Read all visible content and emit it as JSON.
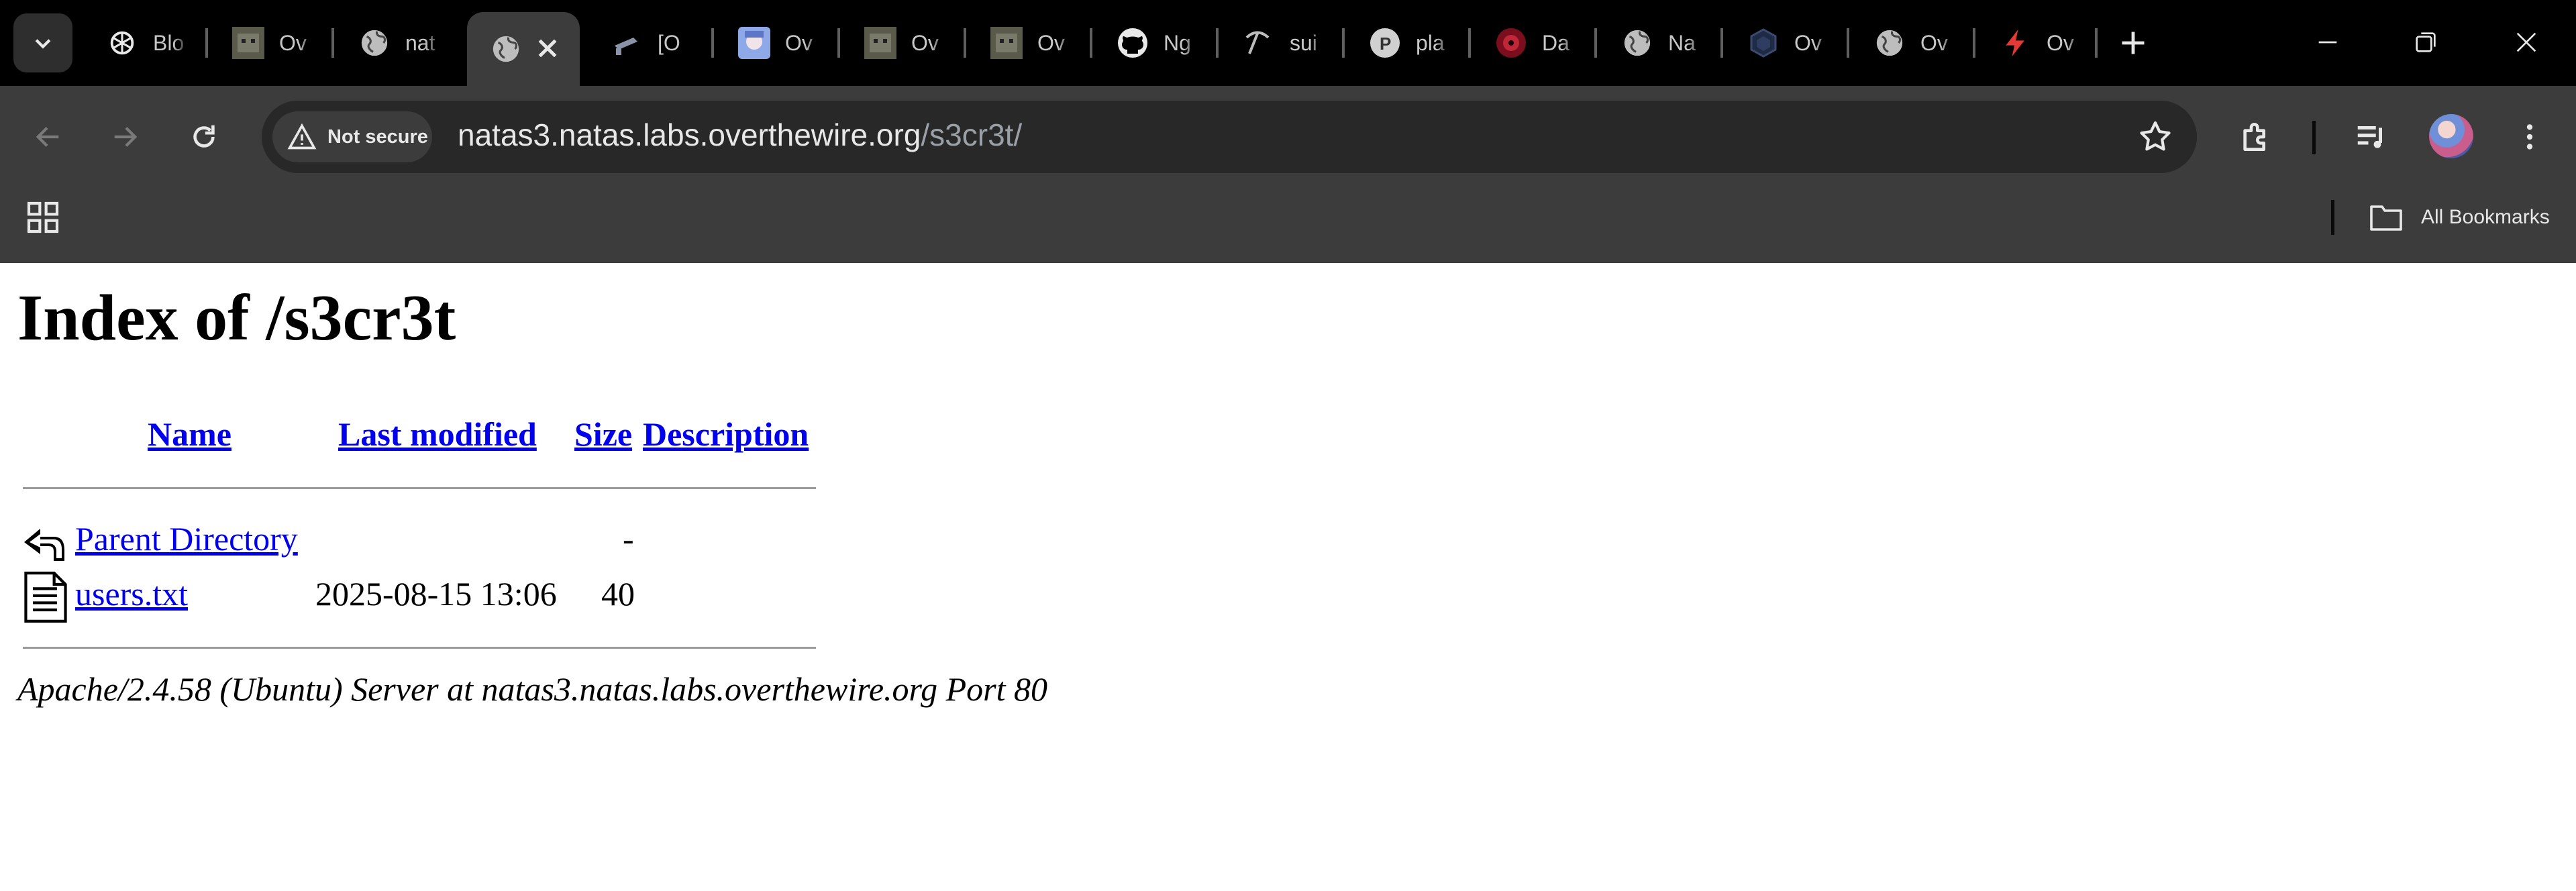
{
  "browser": {
    "tabs": [
      {
        "label": "Blo",
        "icon": "openai-icon"
      },
      {
        "label": "Ov",
        "icon": "cat-icon"
      },
      {
        "label": "nat",
        "icon": "globe-icon"
      },
      {
        "label": "",
        "icon": "globe-icon",
        "active": true
      },
      {
        "label": "[O",
        "icon": "camera-icon"
      },
      {
        "label": "Ov",
        "icon": "anime-avatar-icon"
      },
      {
        "label": "Ov",
        "icon": "cat-icon"
      },
      {
        "label": "Ov",
        "icon": "cat-icon"
      },
      {
        "label": "Ng",
        "icon": "github-icon"
      },
      {
        "label": "sui",
        "icon": "pickaxe-icon"
      },
      {
        "label": "pla",
        "icon": "p-circle-icon"
      },
      {
        "label": "Da",
        "icon": "red-circle-icon"
      },
      {
        "label": "Na",
        "icon": "globe-icon"
      },
      {
        "label": "Ov",
        "icon": "cube-icon"
      },
      {
        "label": "Ov",
        "icon": "globe-icon"
      },
      {
        "label": "Ov",
        "icon": "bolt-icon"
      }
    ],
    "security_label": "Not secure",
    "url_host": "natas3.natas.labs.overthewire.org",
    "url_path": "/s3cr3t/",
    "all_bookmarks_label": "All Bookmarks"
  },
  "page": {
    "title": "Index of /s3cr3t",
    "columns": {
      "name": "Name",
      "last_modified": "Last modified",
      "size": "Size",
      "description": "Description"
    },
    "rows": [
      {
        "name": "Parent Directory",
        "last_modified": "",
        "size": "-",
        "icon": "back-arrow-icon"
      },
      {
        "name": "users.txt",
        "last_modified": "2025-08-15 13:06",
        "size": "40",
        "icon": "text-file-icon"
      }
    ],
    "footer": "Apache/2.4.58 (Ubuntu) Server at natas3.natas.labs.overthewire.org Port 80"
  }
}
